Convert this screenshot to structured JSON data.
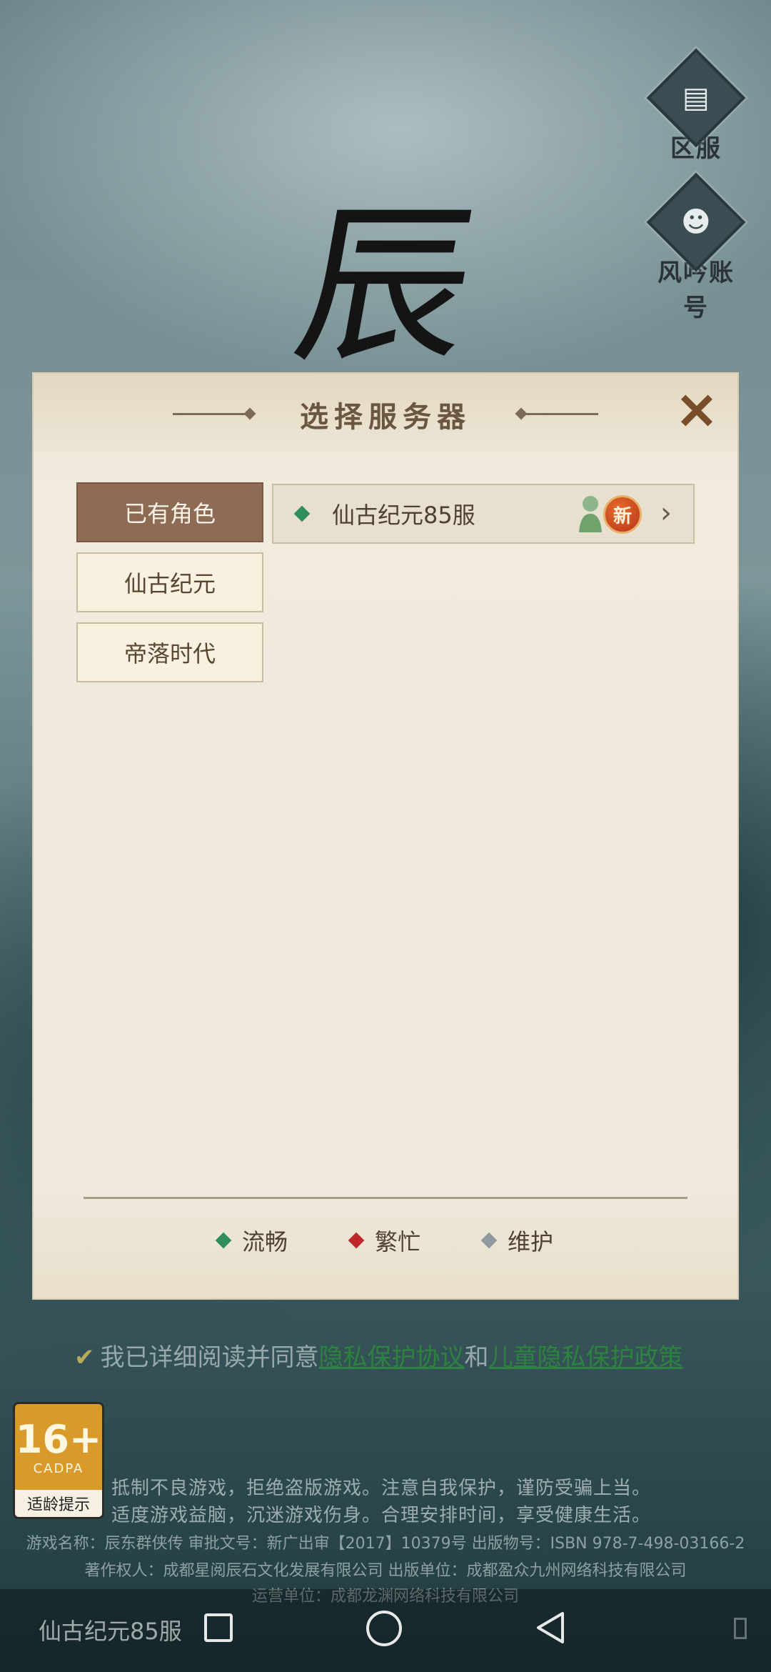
{
  "background": {
    "logo_char": "辰",
    "side_buttons": [
      {
        "label": "区服",
        "icon": "server-icon"
      },
      {
        "label": "风吟账号",
        "icon": "account-icon"
      }
    ]
  },
  "dialog": {
    "title": "选择服务器",
    "close_icon": "close-icon",
    "categories": [
      {
        "label": "已有角色",
        "active": true
      },
      {
        "label": "仙古纪元",
        "active": false
      },
      {
        "label": "帝落时代",
        "active": false
      }
    ],
    "servers": [
      {
        "name": "仙古纪元85服",
        "status": "smooth",
        "badge": "新"
      }
    ],
    "legend": [
      {
        "label": "流畅",
        "color": "#2f8f5b"
      },
      {
        "label": "繁忙",
        "color": "#c0272d"
      },
      {
        "label": "维护",
        "color": "#8f9aa0"
      }
    ]
  },
  "footer": {
    "agree_prefix": "我已详细阅读并同意",
    "link1": "隐私保护协议",
    "and": "和",
    "link2": "儿童隐私保护政策",
    "age_rating": "16+",
    "age_org": "CADPA",
    "age_tip": "适龄提示",
    "notice_line1": "抵制不良游戏，拒绝盗版游戏。注意自我保护，谨防受骗上当。",
    "notice_line2": "适度游戏益脑，沉迷游戏伤身。合理安排时间，享受健康生活。",
    "info_line1": "游戏名称：辰东群侠传 审批文号：新广出审【2017】10379号 出版物号：ISBN 978-7-498-03166-2",
    "info_line2": "著作权人：成都星阅辰石文化发展有限公司 出版单位：成都盈众九州网络科技有限公司",
    "info_line3": "运营单位：成都龙渊网络科技有限公司"
  },
  "navbar": {
    "current_server": "仙古纪元85服"
  },
  "colors": {
    "smooth": "#2f8f5b",
    "busy": "#c0272d",
    "maintenance": "#8f9aa0",
    "active_tab": "#8d6b54"
  }
}
